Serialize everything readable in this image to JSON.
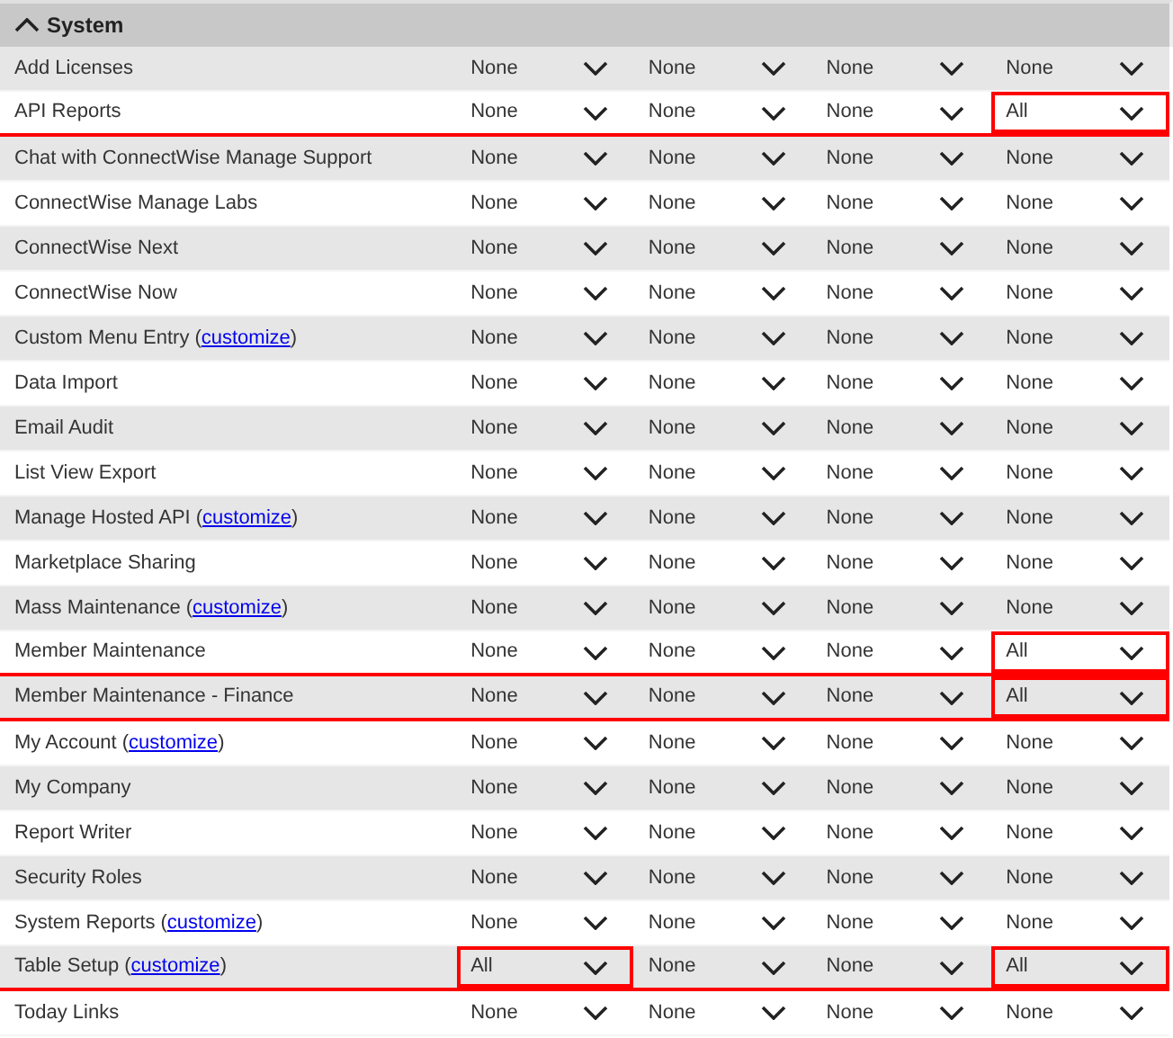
{
  "section": {
    "title": "System",
    "expanded": true
  },
  "rows": [
    {
      "name": "Add Licenses",
      "highlighted": false,
      "cells": [
        {
          "value": "None",
          "highlighted": false
        },
        {
          "value": "None",
          "highlighted": false
        },
        {
          "value": "None",
          "highlighted": false
        },
        {
          "value": "None",
          "highlighted": false
        }
      ]
    },
    {
      "name": "API Reports",
      "highlighted": true,
      "cells": [
        {
          "value": "None",
          "highlighted": false
        },
        {
          "value": "None",
          "highlighted": false
        },
        {
          "value": "None",
          "highlighted": false
        },
        {
          "value": "All",
          "highlighted": true
        }
      ]
    },
    {
      "name": "Chat with ConnectWise Manage Support",
      "highlighted": false,
      "cells": [
        {
          "value": "None",
          "highlighted": false
        },
        {
          "value": "None",
          "highlighted": false
        },
        {
          "value": "None",
          "highlighted": false
        },
        {
          "value": "None",
          "highlighted": false
        }
      ]
    },
    {
      "name": "ConnectWise Manage Labs",
      "highlighted": false,
      "cells": [
        {
          "value": "None",
          "highlighted": false
        },
        {
          "value": "None",
          "highlighted": false
        },
        {
          "value": "None",
          "highlighted": false
        },
        {
          "value": "None",
          "highlighted": false
        }
      ]
    },
    {
      "name": "ConnectWise Next",
      "highlighted": false,
      "cells": [
        {
          "value": "None",
          "highlighted": false
        },
        {
          "value": "None",
          "highlighted": false
        },
        {
          "value": "None",
          "highlighted": false
        },
        {
          "value": "None",
          "highlighted": false
        }
      ]
    },
    {
      "name": "ConnectWise Now",
      "highlighted": false,
      "cells": [
        {
          "value": "None",
          "highlighted": false
        },
        {
          "value": "None",
          "highlighted": false
        },
        {
          "value": "None",
          "highlighted": false
        },
        {
          "value": "None",
          "highlighted": false
        }
      ]
    },
    {
      "name": "Custom Menu Entry",
      "open": "(",
      "link": "customize",
      "close": ")",
      "highlighted": false,
      "cells": [
        {
          "value": "None",
          "highlighted": false
        },
        {
          "value": "None",
          "highlighted": false
        },
        {
          "value": "None",
          "highlighted": false
        },
        {
          "value": "None",
          "highlighted": false
        }
      ]
    },
    {
      "name": "Data Import",
      "highlighted": false,
      "cells": [
        {
          "value": "None",
          "highlighted": false
        },
        {
          "value": "None",
          "highlighted": false
        },
        {
          "value": "None",
          "highlighted": false
        },
        {
          "value": "None",
          "highlighted": false
        }
      ]
    },
    {
      "name": "Email Audit",
      "highlighted": false,
      "cells": [
        {
          "value": "None",
          "highlighted": false
        },
        {
          "value": "None",
          "highlighted": false
        },
        {
          "value": "None",
          "highlighted": false
        },
        {
          "value": "None",
          "highlighted": false
        }
      ]
    },
    {
      "name": "List View Export",
      "highlighted": false,
      "cells": [
        {
          "value": "None",
          "highlighted": false
        },
        {
          "value": "None",
          "highlighted": false
        },
        {
          "value": "None",
          "highlighted": false
        },
        {
          "value": "None",
          "highlighted": false
        }
      ]
    },
    {
      "name": "Manage Hosted API",
      "open": "(",
      "link": "customize",
      "close": ")",
      "highlighted": false,
      "cells": [
        {
          "value": "None",
          "highlighted": false
        },
        {
          "value": "None",
          "highlighted": false
        },
        {
          "value": "None",
          "highlighted": false
        },
        {
          "value": "None",
          "highlighted": false
        }
      ]
    },
    {
      "name": "Marketplace Sharing",
      "highlighted": false,
      "cells": [
        {
          "value": "None",
          "highlighted": false
        },
        {
          "value": "None",
          "highlighted": false
        },
        {
          "value": "None",
          "highlighted": false
        },
        {
          "value": "None",
          "highlighted": false
        }
      ]
    },
    {
      "name": "Mass Maintenance",
      "open": "(",
      "link": "customize",
      "close": ")",
      "highlighted": false,
      "cells": [
        {
          "value": "None",
          "highlighted": false
        },
        {
          "value": "None",
          "highlighted": false
        },
        {
          "value": "None",
          "highlighted": false
        },
        {
          "value": "None",
          "highlighted": false
        }
      ]
    },
    {
      "name": "Member Maintenance",
      "highlighted": true,
      "cells": [
        {
          "value": "None",
          "highlighted": false
        },
        {
          "value": "None",
          "highlighted": false
        },
        {
          "value": "None",
          "highlighted": false
        },
        {
          "value": "All",
          "highlighted": true
        }
      ]
    },
    {
      "name": "Member Maintenance - Finance",
      "highlighted": true,
      "cells": [
        {
          "value": "None",
          "highlighted": false
        },
        {
          "value": "None",
          "highlighted": false
        },
        {
          "value": "None",
          "highlighted": false
        },
        {
          "value": "All",
          "highlighted": true
        }
      ]
    },
    {
      "name": "My Account",
      "open": "(",
      "link": "customize",
      "close": ")",
      "highlighted": false,
      "cells": [
        {
          "value": "None",
          "highlighted": false
        },
        {
          "value": "None",
          "highlighted": false
        },
        {
          "value": "None",
          "highlighted": false
        },
        {
          "value": "None",
          "highlighted": false
        }
      ]
    },
    {
      "name": "My Company",
      "highlighted": false,
      "cells": [
        {
          "value": "None",
          "highlighted": false
        },
        {
          "value": "None",
          "highlighted": false
        },
        {
          "value": "None",
          "highlighted": false
        },
        {
          "value": "None",
          "highlighted": false
        }
      ]
    },
    {
      "name": "Report Writer",
      "highlighted": false,
      "cells": [
        {
          "value": "None",
          "highlighted": false
        },
        {
          "value": "None",
          "highlighted": false
        },
        {
          "value": "None",
          "highlighted": false
        },
        {
          "value": "None",
          "highlighted": false
        }
      ]
    },
    {
      "name": "Security Roles",
      "highlighted": false,
      "cells": [
        {
          "value": "None",
          "highlighted": false
        },
        {
          "value": "None",
          "highlighted": false
        },
        {
          "value": "None",
          "highlighted": false
        },
        {
          "value": "None",
          "highlighted": false
        }
      ]
    },
    {
      "name": "System Reports",
      "open": "(",
      "link": "customize",
      "close": ")",
      "highlighted": false,
      "cells": [
        {
          "value": "None",
          "highlighted": false
        },
        {
          "value": "None",
          "highlighted": false
        },
        {
          "value": "None",
          "highlighted": false
        },
        {
          "value": "None",
          "highlighted": false
        }
      ]
    },
    {
      "name": "Table Setup",
      "open": "(",
      "link": "customize",
      "close": ")",
      "highlighted": true,
      "cells": [
        {
          "value": "All",
          "highlighted": true
        },
        {
          "value": "None",
          "highlighted": false
        },
        {
          "value": "None",
          "highlighted": false
        },
        {
          "value": "All",
          "highlighted": true
        }
      ]
    },
    {
      "name": "Today Links",
      "highlighted": false,
      "cells": [
        {
          "value": "None",
          "highlighted": false
        },
        {
          "value": "None",
          "highlighted": false
        },
        {
          "value": "None",
          "highlighted": false
        },
        {
          "value": "None",
          "highlighted": false
        }
      ]
    }
  ]
}
